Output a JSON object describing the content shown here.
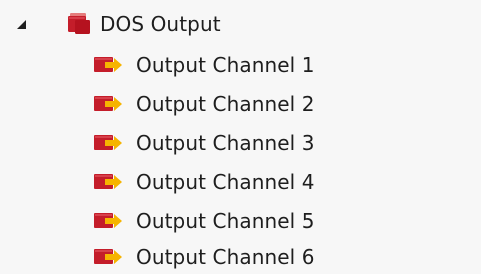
{
  "colors": {
    "background": "#f7f7f7",
    "text": "#1e1e1e",
    "device_red": "#c41d2a",
    "arrow_yellow": "#f6b400"
  },
  "tree": {
    "root": {
      "label": "DOS Output",
      "expander_icon": "expanded-triangle-icon",
      "icon": "device-module-icon"
    },
    "children": [
      {
        "label": "Output Channel 1",
        "icon": "output-channel-icon"
      },
      {
        "label": "Output Channel 2",
        "icon": "output-channel-icon"
      },
      {
        "label": "Output Channel 3",
        "icon": "output-channel-icon"
      },
      {
        "label": "Output Channel 4",
        "icon": "output-channel-icon"
      },
      {
        "label": "Output Channel 5",
        "icon": "output-channel-icon"
      },
      {
        "label": "Output Channel 6",
        "icon": "output-channel-icon"
      }
    ]
  }
}
